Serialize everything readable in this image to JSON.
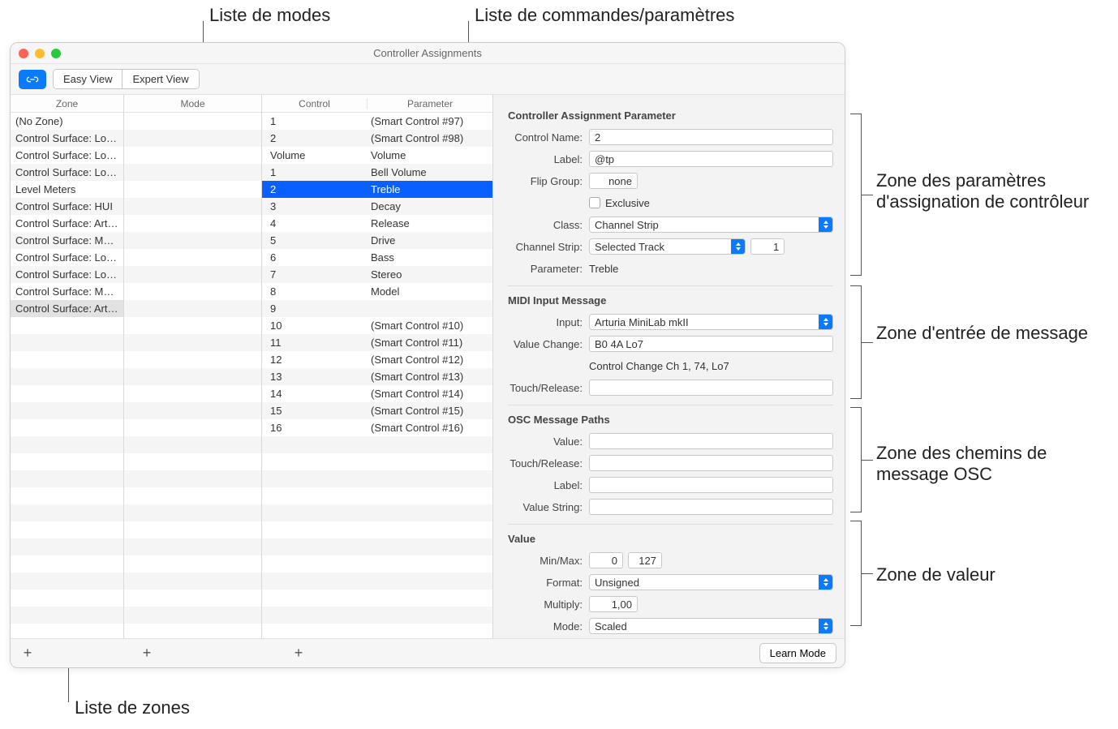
{
  "callouts": {
    "modes": "Liste de modes",
    "controlparams": "Liste de commandes/paramètres",
    "zones": "Liste de zones",
    "param_area": "Zone des paramètres d'assignation de contrôleur",
    "msg_area": "Zone d'entrée de message",
    "osc_area": "Zone des chemins de message OSC",
    "value_area": "Zone de valeur"
  },
  "window": {
    "title": "Controller Assignments"
  },
  "toolbar": {
    "easy": "Easy View",
    "expert": "Expert View"
  },
  "headers": {
    "zone": "Zone",
    "mode": "Mode",
    "control": "Control",
    "parameter": "Parameter"
  },
  "zones": [
    "(No Zone)",
    "Control Surface: Log…",
    "Control Surface: Log…",
    "Control Surface: Log…",
    "Level Meters",
    "Control Surface: HUI",
    "Control Surface: Art…",
    "Control Surface: Ma…",
    "Control Surface: Log…",
    "Control Surface: Log…",
    "Control Surface: Ma…",
    "Control Surface: Art…"
  ],
  "zone_selected_index": 11,
  "controls": [
    {
      "c": "1",
      "p": "(Smart Control #97)"
    },
    {
      "c": "2",
      "p": "(Smart Control #98)"
    },
    {
      "c": "Volume",
      "p": "Volume"
    },
    {
      "c": "1",
      "p": "Bell Volume"
    },
    {
      "c": "2",
      "p": "Treble"
    },
    {
      "c": "3",
      "p": "Decay"
    },
    {
      "c": "4",
      "p": "Release"
    },
    {
      "c": "5",
      "p": "Drive"
    },
    {
      "c": "6",
      "p": "Bass"
    },
    {
      "c": "7",
      "p": "Stereo"
    },
    {
      "c": "8",
      "p": "Model"
    },
    {
      "c": "9",
      "p": ""
    },
    {
      "c": "10",
      "p": "(Smart Control #10)"
    },
    {
      "c": "11",
      "p": "(Smart Control #11)"
    },
    {
      "c": "12",
      "p": "(Smart Control #12)"
    },
    {
      "c": "13",
      "p": "(Smart Control #13)"
    },
    {
      "c": "14",
      "p": "(Smart Control #14)"
    },
    {
      "c": "15",
      "p": "(Smart Control #15)"
    },
    {
      "c": "16",
      "p": "(Smart Control #16)"
    }
  ],
  "control_selected_index": 4,
  "details": {
    "section_cap": "Controller Assignment Parameter",
    "control_name_lbl": "Control Name:",
    "control_name": "2",
    "label_lbl": "Label:",
    "label": "@tp",
    "flip_lbl": "Flip Group:",
    "flip": "none",
    "exclusive_lbl": "Exclusive",
    "class_lbl": "Class:",
    "class": "Channel Strip",
    "chstrip_lbl": "Channel Strip:",
    "chstrip": "Selected Track",
    "chstrip_num": "1",
    "parameter_lbl": "Parameter:",
    "parameter": "Treble",
    "section_midi": "MIDI Input Message",
    "input_lbl": "Input:",
    "input": "Arturia MiniLab mkII",
    "valchange_lbl": "Value Change:",
    "valchange": "B0 4A Lo7",
    "valchange_desc": "Control Change Ch 1, 74, Lo7",
    "touchrel_lbl": "Touch/Release:",
    "section_osc": "OSC Message Paths",
    "osc_value_lbl": "Value:",
    "osc_touchrel_lbl": "Touch/Release:",
    "osc_label_lbl": "Label:",
    "osc_valstr_lbl": "Value String:",
    "section_value": "Value",
    "minmax_lbl": "Min/Max:",
    "min": "0",
    "max": "127",
    "format_lbl": "Format:",
    "format": "Unsigned",
    "multiply_lbl": "Multiply:",
    "multiply": "1,00",
    "mode_lbl": "Mode:",
    "mode": "Scaled"
  },
  "footer": {
    "learn": "Learn Mode"
  }
}
